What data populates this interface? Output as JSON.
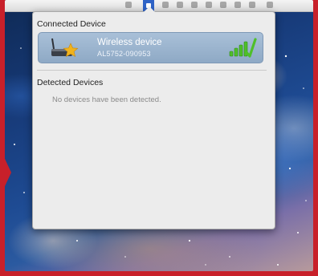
{
  "menubar": {
    "active_icon": "wireless-status-icon"
  },
  "popup": {
    "connected_section_title": "Connected Device",
    "device": {
      "name": "Wireless device",
      "id": "AL5752-090953",
      "icon": "router-star-icon",
      "signal_icon": "signal-strength-icon"
    },
    "detected_section_title": "Detected Devices",
    "empty_message": "No devices have been detected."
  },
  "colors": {
    "popup_bg": "#ececec",
    "selected_row": "#9cb5d0",
    "signal_green": "#4fbf2a",
    "star_yellow": "#f0b31c",
    "frame_red": "#c8202a"
  }
}
